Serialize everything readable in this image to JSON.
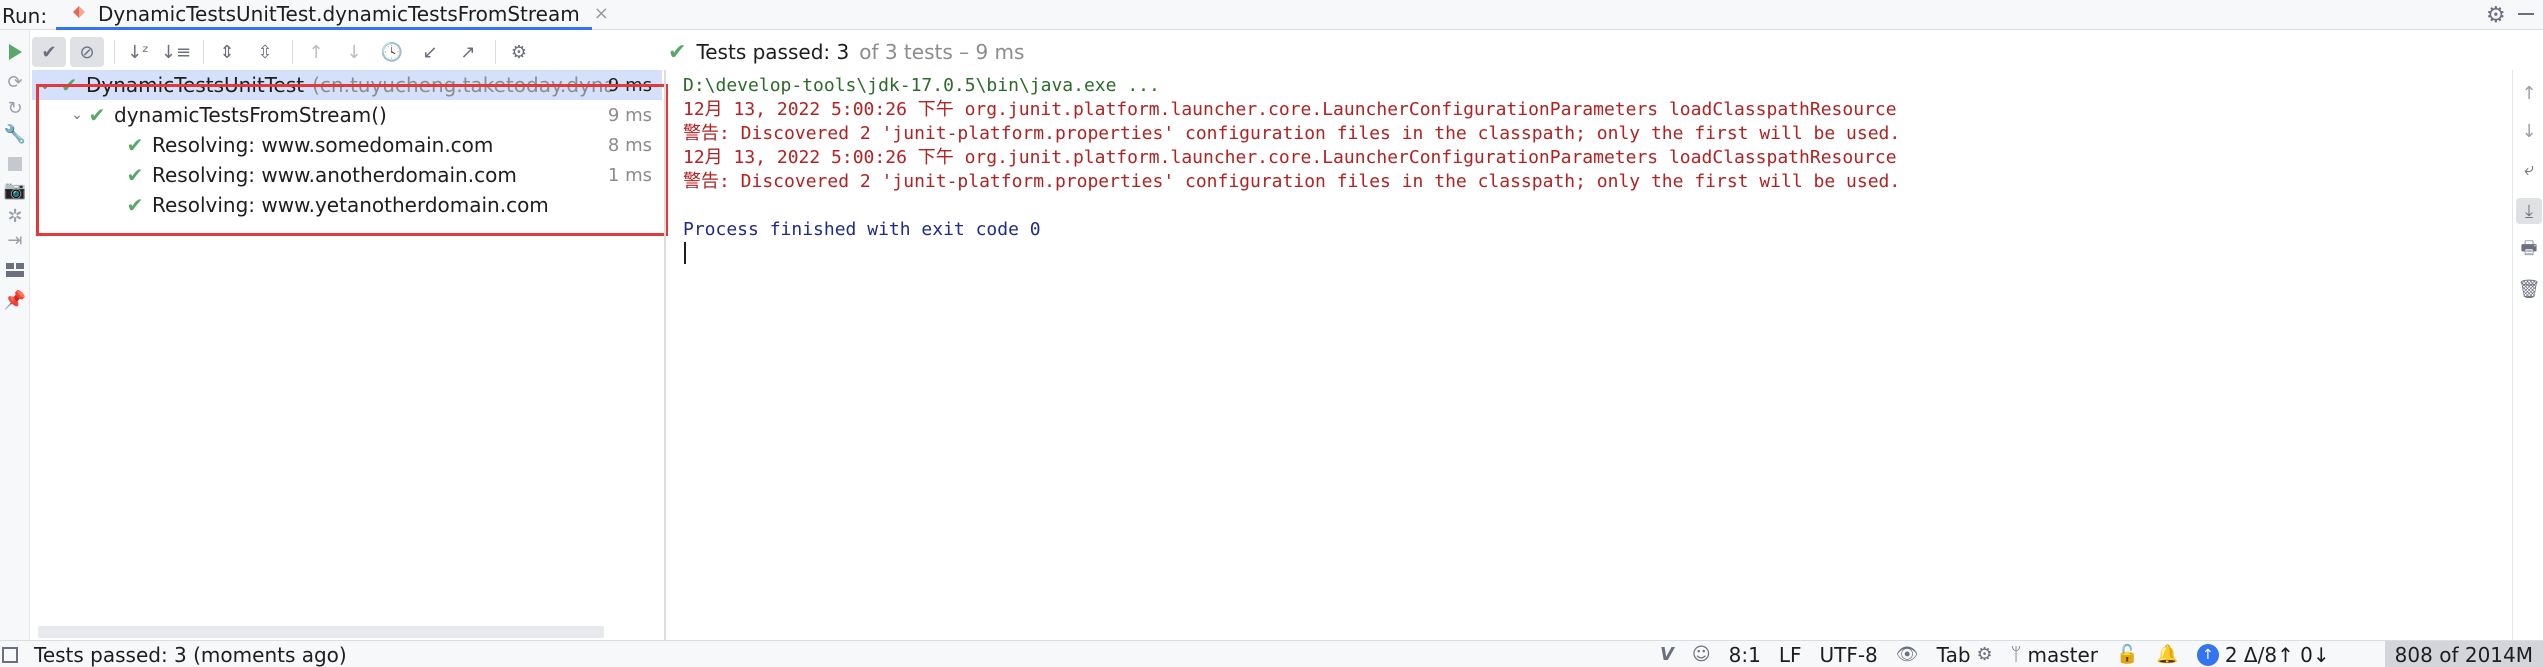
{
  "topbar": {
    "run_label": "Run:",
    "tab_title": "DynamicTestsUnitTest.dynamicTestsFromStream",
    "tab_close": "×",
    "settings_icon": "gear-icon",
    "minimize_icon": "minimize-icon"
  },
  "left_toolbar": {
    "icons": [
      "rerun-icon",
      "rerun-failed-icon",
      "toggle-auto-test-icon",
      "wrench-icon",
      "stop-icon",
      "screenshot-icon",
      "debug-icon",
      "exit-icon",
      "layout-icon",
      "pin-icon"
    ]
  },
  "test_toolbar": {
    "buttons": [
      "show-passed-icon",
      "show-ignored-icon",
      "sort-alpha-icon",
      "sort-duration-icon",
      "expand-all-icon",
      "collapse-all-icon",
      "prev-test-icon",
      "next-test-icon",
      "history-icon",
      "import-icon",
      "export-icon",
      "settings-icon"
    ]
  },
  "summary": {
    "passed_label": "Tests passed: 3",
    "detail": "of 3 tests – 9 ms"
  },
  "tree": {
    "root": {
      "name": "DynamicTestsUnitTest",
      "package": "(cn.tuyucheng.taketoday.dynami",
      "duration": "9 ms"
    },
    "method": {
      "name": "dynamicTestsFromStream()",
      "duration": "9 ms"
    },
    "children": [
      {
        "name": "Resolving: www.somedomain.com",
        "duration": "8 ms"
      },
      {
        "name": "Resolving: www.anotherdomain.com",
        "duration": "1 ms"
      },
      {
        "name": "Resolving: www.yetanotherdomain.com",
        "duration": ""
      }
    ]
  },
  "console": {
    "lines": [
      {
        "text": "D:\\develop-tools\\jdk-17.0.5\\bin\\java.exe ...",
        "kind": "cmd"
      },
      {
        "text": "12月 13, 2022 5:00:26 下午 org.junit.platform.launcher.core.LauncherConfigurationParameters loadClasspathResource",
        "kind": "err"
      },
      {
        "text": "警告: Discovered 2 'junit-platform.properties' configuration files in the classpath; only the first will be used.",
        "kind": "err"
      },
      {
        "text": "12月 13, 2022 5:00:26 下午 org.junit.platform.launcher.core.LauncherConfigurationParameters loadClasspathResource",
        "kind": "err"
      },
      {
        "text": "警告: Discovered 2 'junit-platform.properties' configuration files in the classpath; only the first will be used.",
        "kind": "err"
      },
      {
        "text": "",
        "kind": "ok"
      },
      {
        "text": "Process finished with exit code 0",
        "kind": "ok"
      }
    ]
  },
  "right_toolbar": {
    "icons": [
      "scroll-up-icon",
      "scroll-down-icon",
      "soft-wrap-icon",
      "scroll-to-end-icon",
      "print-icon",
      "clear-all-icon"
    ]
  },
  "statusbar": {
    "message": "Tests passed: 3 (moments ago)",
    "position": "8:1",
    "line_ending": "LF",
    "encoding": "UTF-8",
    "indent": "Tab",
    "branch": "master",
    "vcs_status": "2 Δ/8↑ 0↓",
    "memory": "808 of 2014M",
    "colors": {
      "accent": "#3574f0",
      "pass": "#59a869",
      "error_text": "#b22222",
      "highlight_frame": "#e23a3a"
    }
  }
}
